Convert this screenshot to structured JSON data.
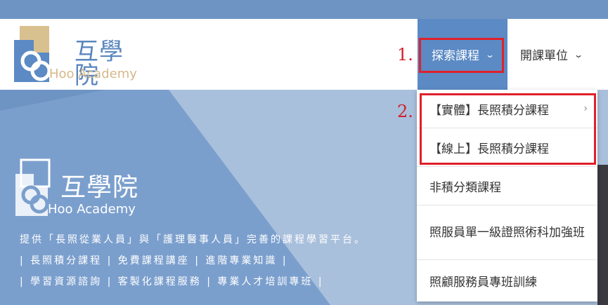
{
  "brand": {
    "name_cn": "互學院",
    "name_en": "Hoo Academy",
    "primary_color": "#5b8ac4",
    "accent_color": "#d4b98a"
  },
  "nav": {
    "explore_label": "探索課程",
    "units_label": "開課單位",
    "chevron": "⌄"
  },
  "annotations": {
    "step1": "1.",
    "step2": "2."
  },
  "dropdown": {
    "items": [
      {
        "label": "【實體】長照積分課程",
        "has_submenu": true
      },
      {
        "label": "【線上】長照積分課程",
        "has_submenu": false
      },
      {
        "label": "非積分類課程",
        "has_submenu": false
      },
      {
        "label": "照服員單一級證照術科加強班",
        "has_submenu": false
      },
      {
        "label": "照顧服務員專班訓練",
        "has_submenu": false
      }
    ],
    "submenu_arrow": "›"
  },
  "hero": {
    "tagline1": "提供「長照從業人員」與「護理醫事人員」完善的課程學習平台。",
    "tagline2": "| 長照積分課程 | 免費課程講座 | 進階專業知識 |",
    "tagline3": "| 學習資源諮詢 | 客製化課程服務 | 專業人才培訓專班 |"
  },
  "colors": {
    "highlight_red": "#e0202a",
    "top_strip": "#6e94c4"
  }
}
